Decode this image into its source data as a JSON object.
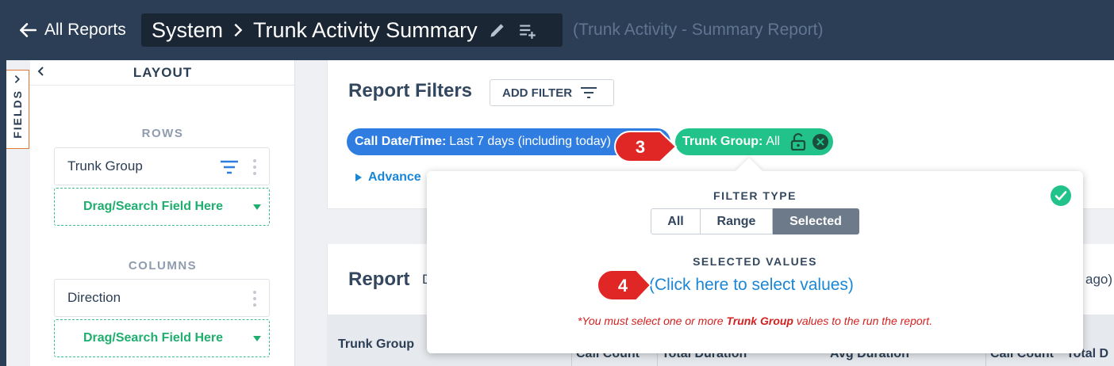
{
  "header": {
    "back_label": "All Reports",
    "breadcrumb_parent": "System",
    "report_name": "Trunk Activity Summary",
    "report_type": "(Trunk Activity - Summary Report)"
  },
  "fields_tab": {
    "label": "FIELDS"
  },
  "layout_panel": {
    "title": "LAYOUT",
    "rows_label": "ROWS",
    "rows_field": "Trunk Group",
    "rows_drop": "Drag/Search Field Here",
    "columns_label": "COLUMNS",
    "columns_field": "Direction",
    "columns_drop": "Drag/Search Field Here"
  },
  "filters": {
    "title": "Report Filters",
    "add_filter": "ADD FILTER",
    "chip1_key": "Call Date/Time:",
    "chip1_value": "Last 7 days (including today)",
    "chip2_key": "Trunk Group:",
    "chip2_value": "All",
    "advanced": "Advance"
  },
  "report": {
    "title": "Report",
    "fragment": "D",
    "ago": "ago)",
    "col_trunk_group": "Trunk Group",
    "col_call_count": "Call Count",
    "col_total_duration": "Total Duration",
    "col_avg_duration": "Avg Duration",
    "col_call_count_2": "Call Count",
    "col_total_duration_2": "Total D"
  },
  "popup": {
    "filter_type_label": "FILTER TYPE",
    "options": [
      "All",
      "Range",
      "Selected"
    ],
    "selected_option": "Selected",
    "selected_values_label": "SELECTED VALUES",
    "select_link": "(Click here to select values)",
    "warn_before": "*You must select one or more ",
    "warn_field": "Trunk Group",
    "warn_after": " values to the run the report."
  },
  "callouts": {
    "step3": "3",
    "step4": "4"
  },
  "colors": {
    "header_bg": "#2c3e55",
    "chip_blue": "#2f7de1",
    "chip_green": "#21c38a",
    "link_blue": "#1a86d6",
    "callout_red": "#e12626",
    "warning_red": "#d42020"
  }
}
